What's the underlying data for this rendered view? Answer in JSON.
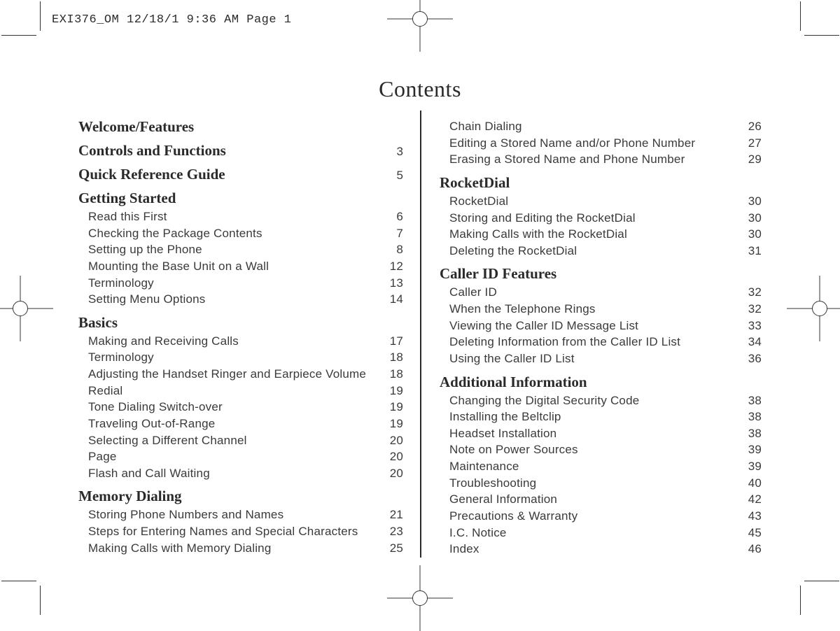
{
  "header": "EXI376_OM  12/18/1 9:36 AM  Page 1",
  "title": "Contents",
  "left_sections": [
    {
      "heading": "Welcome/Features",
      "page": "",
      "items": []
    },
    {
      "heading": "Controls and Functions",
      "page": "3",
      "items": []
    },
    {
      "heading": "Quick Reference Guide",
      "page": "5",
      "items": []
    },
    {
      "heading": "Getting Started",
      "page": "",
      "items": [
        {
          "t": "Read this First",
          "p": "6"
        },
        {
          "t": "Checking the Package Contents",
          "p": "7"
        },
        {
          "t": "Setting up the Phone",
          "p": "8"
        },
        {
          "t": "Mounting the Base Unit on a Wall",
          "p": "12"
        },
        {
          "t": "Terminology",
          "p": "13"
        },
        {
          "t": "Setting Menu Options",
          "p": "14"
        }
      ]
    },
    {
      "heading": "Basics",
      "page": "",
      "items": [
        {
          "t": "Making and Receiving Calls",
          "p": "17"
        },
        {
          "t": "Terminology",
          "p": "18"
        },
        {
          "t": "Adjusting the Handset Ringer and Earpiece Volume",
          "p": "18"
        },
        {
          "t": "Redial",
          "p": "19"
        },
        {
          "t": "Tone Dialing Switch-over",
          "p": "19"
        },
        {
          "t": "Traveling Out-of-Range",
          "p": "19"
        },
        {
          "t": "Selecting a Different Channel",
          "p": "20"
        },
        {
          "t": "Page",
          "p": "20"
        },
        {
          "t": "Flash and Call Waiting",
          "p": "20"
        }
      ]
    },
    {
      "heading": "Memory Dialing",
      "page": "",
      "items": [
        {
          "t": "Storing Phone Numbers and Names",
          "p": "21"
        },
        {
          "t": "Steps for Entering Names and Special Characters",
          "p": "23"
        },
        {
          "t": "Making Calls with Memory Dialing",
          "p": "25"
        }
      ]
    }
  ],
  "right_sections": [
    {
      "heading": "",
      "page": "",
      "items": [
        {
          "t": "Chain Dialing",
          "p": "26"
        },
        {
          "t": "Editing a Stored Name and/or Phone Number",
          "p": "27"
        },
        {
          "t": "Erasing a Stored Name and Phone Number",
          "p": "29"
        }
      ]
    },
    {
      "heading": "RocketDial",
      "page": "",
      "items": [
        {
          "t": "RocketDial",
          "p": "30"
        },
        {
          "t": "Storing and Editing the RocketDial",
          "p": "30"
        },
        {
          "t": "Making Calls with the RocketDial",
          "p": "30"
        },
        {
          "t": "Deleting the RocketDial",
          "p": "31"
        }
      ]
    },
    {
      "heading": "Caller ID Features",
      "page": "",
      "items": [
        {
          "t": "Caller ID",
          "p": "32"
        },
        {
          "t": "When the Telephone Rings",
          "p": "32"
        },
        {
          "t": "Viewing the Caller ID Message List",
          "p": "33"
        },
        {
          "t": "Deleting Information from the Caller ID List",
          "p": "34"
        },
        {
          "t": "Using the Caller ID List",
          "p": "36"
        }
      ]
    },
    {
      "heading": "Additional Information",
      "page": "",
      "items": [
        {
          "t": "Changing the Digital Security Code",
          "p": "38"
        },
        {
          "t": "Installing the Beltclip",
          "p": "38"
        },
        {
          "t": "Headset Installation",
          "p": "38"
        },
        {
          "t": "Note on Power Sources",
          "p": "39"
        },
        {
          "t": "Maintenance",
          "p": "39"
        },
        {
          "t": "Troubleshooting",
          "p": "40"
        },
        {
          "t": "General Information",
          "p": "42"
        },
        {
          "t": "Precautions & Warranty",
          "p": "43"
        },
        {
          "t": "I.C. Notice",
          "p": "45"
        },
        {
          "t": "Index",
          "p": "46"
        }
      ]
    }
  ]
}
